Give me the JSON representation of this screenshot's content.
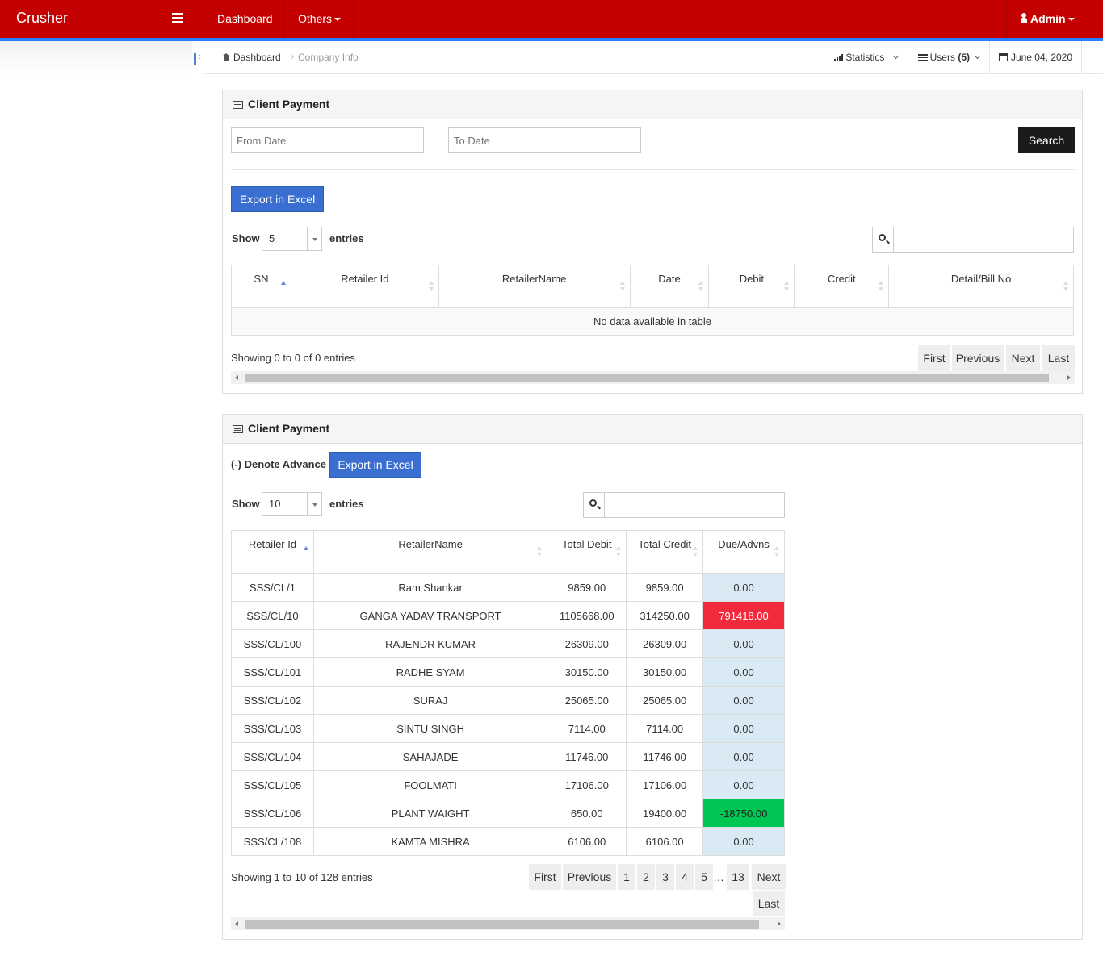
{
  "app": {
    "brand": "Crusher"
  },
  "nav": {
    "dashboard": "Dashboard",
    "others": "Others",
    "admin": "Admin"
  },
  "breadcrumb": {
    "home": "Dashboard",
    "current": "Company Info"
  },
  "header_tools": {
    "statistics": "Statistics",
    "users_label": "Users",
    "users_count": "(5)",
    "date": "June 04, 2020"
  },
  "panel1": {
    "title": "Client Payment",
    "from_placeholder": "From Date",
    "to_placeholder": "To Date",
    "search_button": "Search",
    "export_button": "Export in Excel",
    "show_label": "Show",
    "show_value": "5",
    "entries_label": "entries",
    "columns": [
      "SN",
      "Retailer Id",
      "RetailerName",
      "Date",
      "Debit",
      "Credit",
      "Detail/Bill No"
    ],
    "empty_message": "No data available in table",
    "info": "Showing 0 to 0 of 0 entries",
    "pagination": {
      "first": "First",
      "previous": "Previous",
      "next": "Next",
      "last": "Last"
    }
  },
  "panel2": {
    "title": "Client Payment",
    "denote_label": "(-) Denote Advance",
    "export_button": "Export in Excel",
    "show_label": "Show",
    "show_value": "10",
    "entries_label": "entries",
    "columns": [
      "Retailer Id",
      "RetailerName",
      "Total Debit",
      "Total Credit",
      "Due/Advns"
    ],
    "rows": [
      [
        "SSS/CL/1",
        "Ram Shankar",
        "9859.00",
        "9859.00",
        "0.00"
      ],
      [
        "SSS/CL/10",
        "GANGA YADAV TRANSPORT",
        "1105668.00",
        "314250.00",
        "791418.00"
      ],
      [
        "SSS/CL/100",
        "RAJENDR KUMAR",
        "26309.00",
        "26309.00",
        "0.00"
      ],
      [
        "SSS/CL/101",
        "RADHE SYAM",
        "30150.00",
        "30150.00",
        "0.00"
      ],
      [
        "SSS/CL/102",
        "SURAJ",
        "25065.00",
        "25065.00",
        "0.00"
      ],
      [
        "SSS/CL/103",
        "SINTU SINGH",
        "7114.00",
        "7114.00",
        "0.00"
      ],
      [
        "SSS/CL/104",
        "SAHAJADE",
        "11746.00",
        "11746.00",
        "0.00"
      ],
      [
        "SSS/CL/105",
        "FOOLMATI",
        "17106.00",
        "17106.00",
        "0.00"
      ],
      [
        "SSS/CL/106",
        "PLANT WAIGHT",
        "650.00",
        "19400.00",
        "-18750.00"
      ],
      [
        "SSS/CL/108",
        "KAMTA MISHRA",
        "6106.00",
        "6106.00",
        "0.00"
      ]
    ],
    "info": "Showing 1 to 10 of 128 entries",
    "pagination": {
      "first": "First",
      "previous": "Previous",
      "pages": [
        "1",
        "2",
        "3",
        "4",
        "5"
      ],
      "ellipsis": "…",
      "last_page": "13",
      "next": "Next",
      "last": "Last"
    }
  },
  "colors": {
    "topbar": "#c50000",
    "accent_line": "#2a7fff",
    "export_button": "#3a6fd1",
    "due_positive": "#f22b3c",
    "due_negative": "#00c753",
    "due_zero": "#d9eaf4"
  }
}
